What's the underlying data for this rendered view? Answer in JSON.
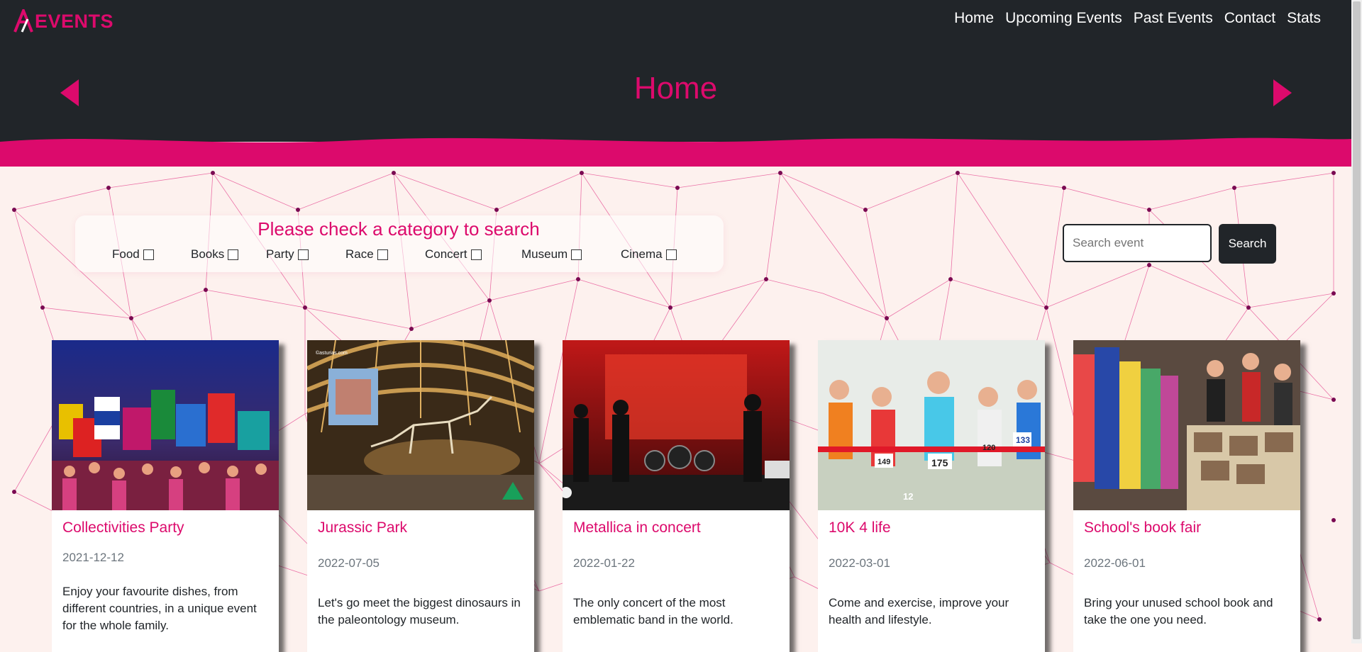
{
  "brand": {
    "logo_text": "EVENTS",
    "logo_mark": "A"
  },
  "nav": [
    {
      "label": "Home"
    },
    {
      "label": "Upcoming Events"
    },
    {
      "label": "Past Events"
    },
    {
      "label": "Contact"
    },
    {
      "label": "Stats"
    }
  ],
  "header": {
    "page_title": "Home",
    "prev_icon": "caret-left-icon",
    "next_icon": "caret-right-icon"
  },
  "filters": {
    "title": "Please check a category to search",
    "categories": [
      {
        "label": "Food",
        "checked": false
      },
      {
        "label": "Books",
        "checked": false
      },
      {
        "label": "Party",
        "checked": false
      },
      {
        "label": "Race",
        "checked": false
      },
      {
        "label": "Concert",
        "checked": false
      },
      {
        "label": "Museum",
        "checked": false
      },
      {
        "label": "Cinema",
        "checked": false
      }
    ]
  },
  "search": {
    "placeholder": "Search event",
    "value": "",
    "button_label": "Search"
  },
  "events": [
    {
      "title": "Collectivities Party",
      "date": "2021-12-12",
      "description": "Enjoy your favourite dishes, from different countries, in a unique event for the whole family.",
      "image": "festival-flags-photo"
    },
    {
      "title": "Jurassic Park",
      "date": "2022-07-05",
      "description": "Let's go meet the biggest dinosaurs in the paleontology museum.",
      "image": "dinosaur-museum-photo",
      "image_caption": "©asturias.com"
    },
    {
      "title": "Metallica in concert",
      "date": "2022-01-22",
      "description": "The only concert of the most emblematic band in the world.",
      "image": "rock-concert-photo"
    },
    {
      "title": "10K 4 life",
      "date": "2022-03-01",
      "description": "Come and exercise, improve your health and lifestyle.",
      "image": "marathon-runners-photo",
      "bib_numbers": [
        "149",
        "175",
        "12",
        "133",
        "120"
      ]
    },
    {
      "title": "School's book fair",
      "date": "2022-06-01",
      "description": "Bring your unused school book and take the one you need.",
      "image": "book-fair-photo"
    }
  ],
  "colors": {
    "accent": "#dc0a6c",
    "dark": "#212529",
    "background": "#fdf1ee",
    "text": "#212529",
    "muted": "#6c757d"
  }
}
